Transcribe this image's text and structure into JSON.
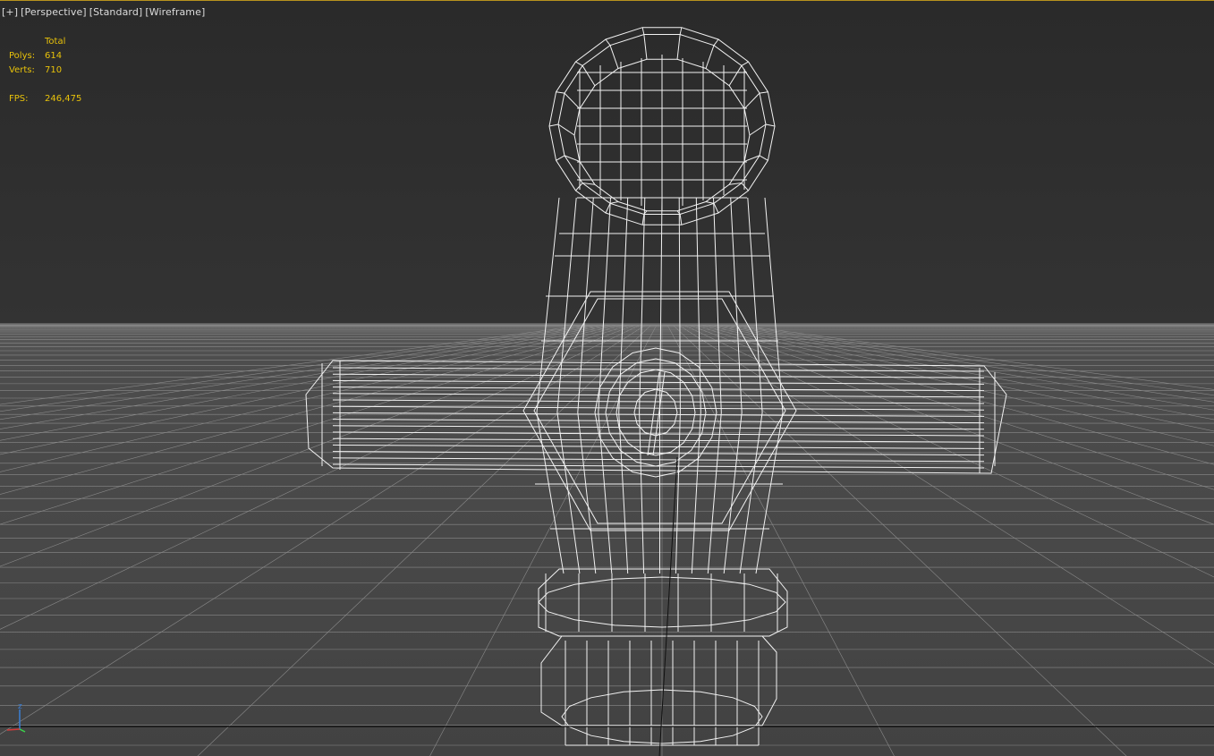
{
  "viewport": {
    "labels": [
      "[+]",
      "[Perspective]",
      "[Standard]",
      "[Wireframe]"
    ]
  },
  "stats": {
    "header": "Total",
    "polys_label": "Polys:",
    "polys_value": "614",
    "verts_label": "Verts:",
    "verts_value": "710",
    "fps_label": "FPS:",
    "fps_value": "246,475"
  },
  "axis": {
    "label": "z"
  },
  "colors": {
    "background_top": "#2b2b2b",
    "ground": "#464646",
    "wire": "#ffffff",
    "stats_text": "#e8c20a",
    "border": "#b8921e",
    "axis_z": "#3a7fd6",
    "axis_x": "#d63a3a",
    "axis_y": "#3ad64a"
  },
  "icons": [
    "gizmo-axis-icon"
  ]
}
